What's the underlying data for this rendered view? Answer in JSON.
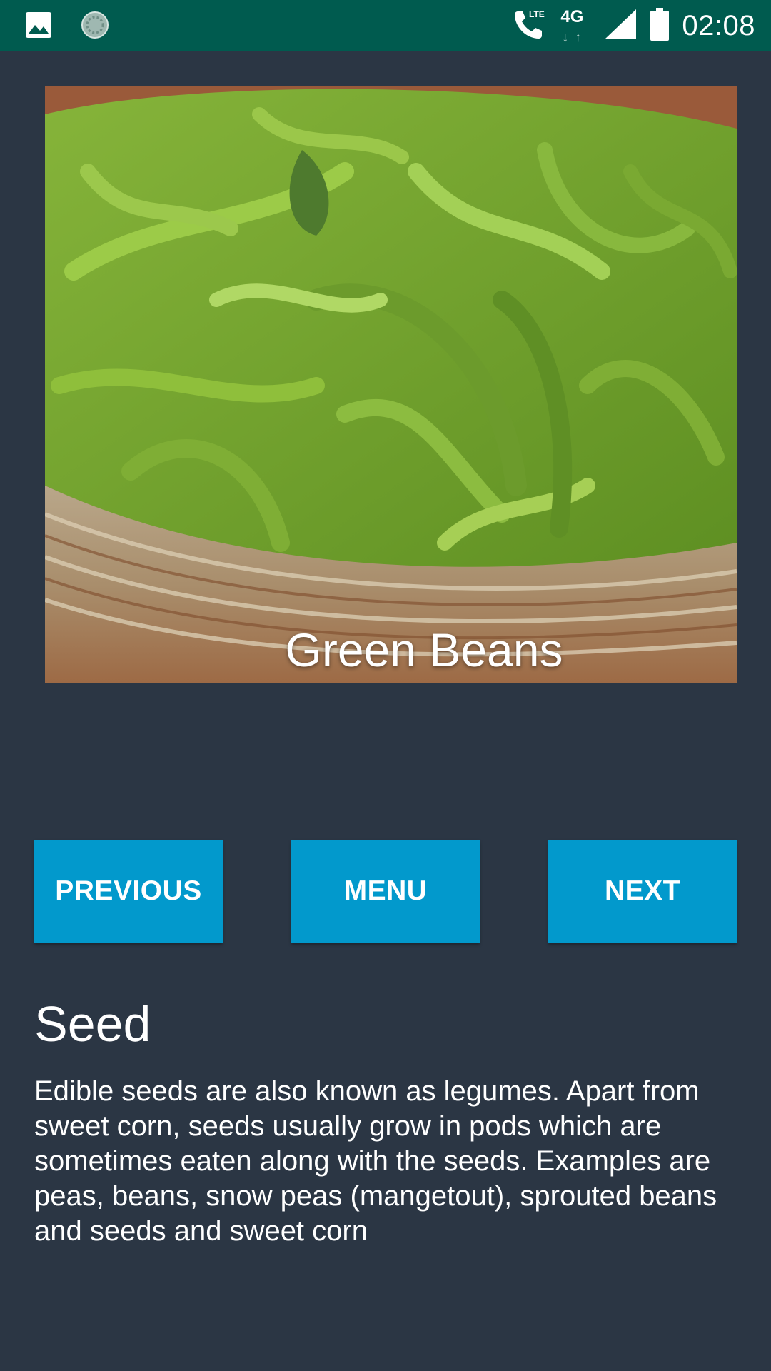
{
  "status_bar": {
    "time": "02:08",
    "network_label": "4G",
    "icons": [
      "image-icon",
      "loading-spinner-icon",
      "lte-call-icon",
      "signal-icon",
      "battery-icon"
    ]
  },
  "hero": {
    "title": "Green Beans"
  },
  "buttons": {
    "previous": "PREVIOUS",
    "menu": "MENU",
    "next": "NEXT"
  },
  "section": {
    "title": "Seed",
    "body": "Edible seeds are also known as legumes. Apart from sweet corn, seeds usually grow in pods which are sometimes eaten along with the seeds. Examples are peas, beans, snow peas (mangetout), sprouted beans and seeds and sweet corn"
  },
  "colors": {
    "background": "#2b3644",
    "status_bar": "#005b4f",
    "button": "#0299cc"
  }
}
